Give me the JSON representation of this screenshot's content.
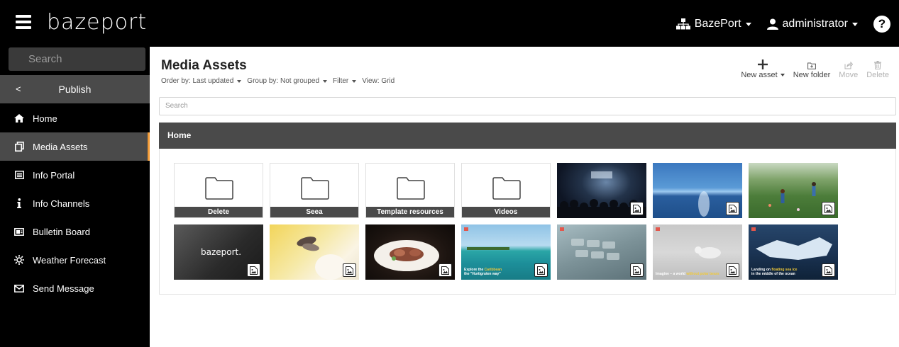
{
  "app": {
    "logo_text": "bazeport",
    "brand_color": "#000000",
    "accent_color": "#f29c38"
  },
  "topbar": {
    "org_label": "BazePort",
    "user_label": "administrator",
    "help_label": "?"
  },
  "sidebar": {
    "search_placeholder": "Search",
    "publish_label": "Publish",
    "back_glyph": "<",
    "items": [
      {
        "label": "Home",
        "icon": "home-icon"
      },
      {
        "label": "Media Assets",
        "icon": "media-icon"
      },
      {
        "label": "Info Portal",
        "icon": "portal-icon"
      },
      {
        "label": "Info Channels",
        "icon": "info-icon"
      },
      {
        "label": "Bulletin Board",
        "icon": "board-icon"
      },
      {
        "label": "Weather Forecast",
        "icon": "weather-icon"
      },
      {
        "label": "Send Message",
        "icon": "envelope-icon"
      }
    ],
    "active_index": 1
  },
  "main": {
    "title": "Media Assets",
    "order_by": "Order by: Last updated",
    "group_by": "Group by: Not grouped",
    "filter": "Filter",
    "view": "View: Grid",
    "actions": {
      "new_asset": "New asset",
      "new_folder": "New folder",
      "move": "Move",
      "delete": "Delete"
    },
    "search_placeholder": "Search",
    "breadcrumb": "Home"
  },
  "folders": [
    {
      "name": "Delete"
    },
    {
      "name": "Seea"
    },
    {
      "name": "Template resources"
    },
    {
      "name": "Videos"
    }
  ],
  "images": [
    {
      "theme": "concert"
    },
    {
      "theme": "sea"
    },
    {
      "theme": "hikers"
    },
    {
      "theme": "bazeport-logo",
      "text": "bazeport."
    },
    {
      "theme": "shells"
    },
    {
      "theme": "food"
    },
    {
      "theme": "caribbean",
      "text_a": "Explore the",
      "text_hl": "Caribbean",
      "text_b": "the \"Hurtigruten way\""
    },
    {
      "theme": "keyboard"
    },
    {
      "theme": "polar",
      "text_a": "Imagine – a world",
      "text_hl": "without polar bears"
    },
    {
      "theme": "ice",
      "text_a": "Landing on",
      "text_hl": "floating sea ice",
      "text_b": "in the middle of the ocean"
    }
  ]
}
